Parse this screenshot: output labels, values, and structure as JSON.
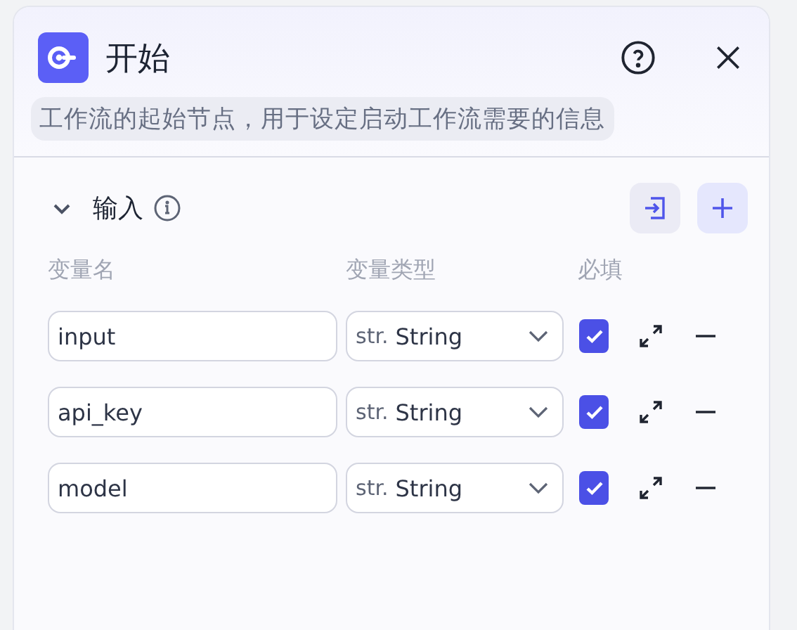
{
  "panel": {
    "title": "开始",
    "description": "工作流的起始节点，用于设定启动工作流需要的信息"
  },
  "section": {
    "title": "输入",
    "expanded": true
  },
  "columns": [
    "变量名",
    "变量类型",
    "必填"
  ],
  "variables": [
    {
      "name": "input",
      "type_prefix": "str.",
      "type": "String",
      "required": true
    },
    {
      "name": "api_key",
      "type_prefix": "str.",
      "type": "String",
      "required": true
    },
    {
      "name": "model",
      "type_prefix": "str.",
      "type": "String",
      "required": true
    }
  ]
}
